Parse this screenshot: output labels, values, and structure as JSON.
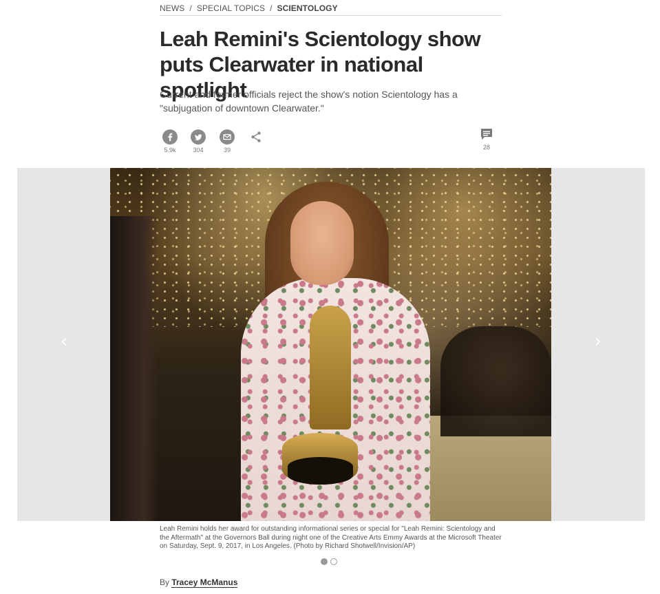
{
  "breadcrumb": {
    "items": [
      "NEWS",
      "SPECIAL TOPICS",
      "SCIENTOLOGY"
    ],
    "separator": "/"
  },
  "article": {
    "headline": "Leah Remini's Scientology show puts Clearwater in national spotlight",
    "dek": "Current and former officials reject the show's notion Scientology has a \"subjugation of downtown Clearwater.\"",
    "byline_prefix": "By",
    "author": "Tracey McManus"
  },
  "share": {
    "facebook_icon": "facebook-icon",
    "facebook_count": "5.9k",
    "twitter_icon": "twitter-icon",
    "twitter_count": "304",
    "email_icon": "email-icon",
    "email_count": "39",
    "share_icon": "share-icon",
    "comments_icon": "comments-icon",
    "comments_count": "28"
  },
  "gallery": {
    "caption": "Leah Remini holds her award for outstanding informational series or special for \"Leah Remini: Scientology and the Aftermath\" at the Governors Ball during night one of the Creative Arts Emmy Awards at the Microsoft Theater on Saturday, Sept. 9, 2017, in Los Angeles. (Photo by Richard Shotwell/Invision/AP)",
    "prev_arrow": "‹",
    "next_arrow": "›",
    "slide_count": 2,
    "active_slide": 1
  },
  "colors": {
    "icon_gray": "#8a8a8a",
    "text_dark": "#2a2a2a",
    "gallery_bg": "#e6e6e6"
  }
}
